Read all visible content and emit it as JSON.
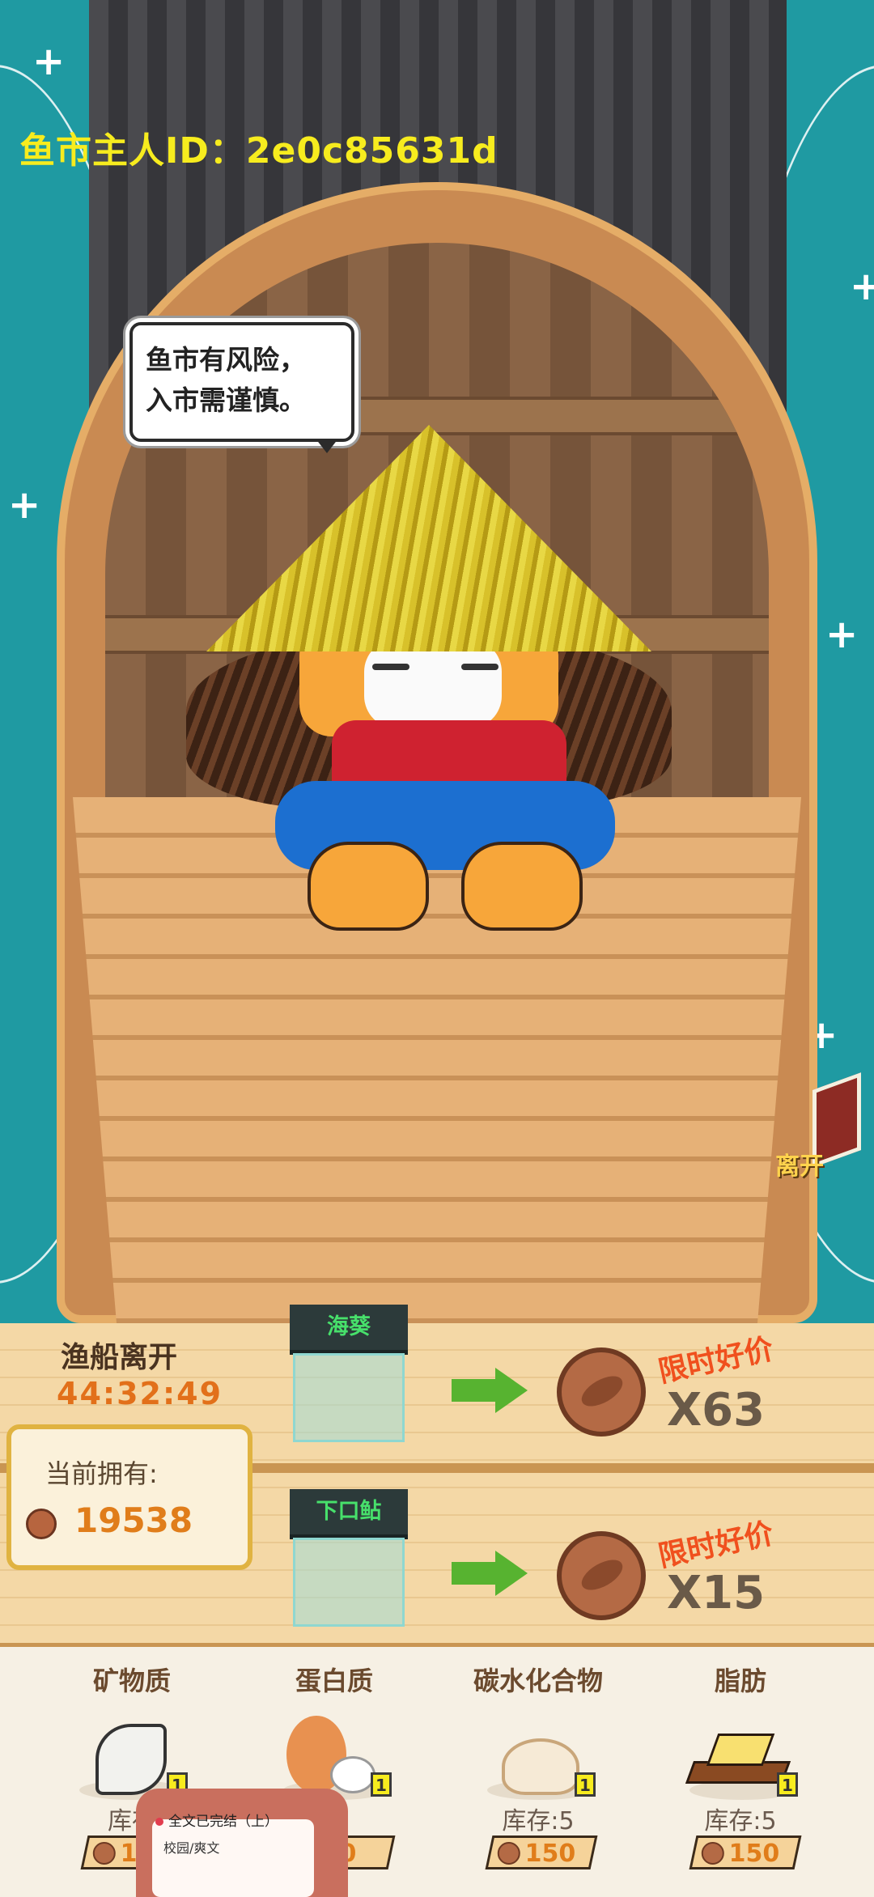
{
  "header": {
    "owner_id": "鱼市主人ID：2e0c85631d"
  },
  "speech": {
    "line1": "鱼市有风险，",
    "line2": "入市需谨慎。"
  },
  "leave": {
    "label": "离开"
  },
  "boat": {
    "title": "渔船离开",
    "timer": "44:32:49",
    "owned_label": "当前拥有:",
    "owned_value": "19538"
  },
  "offers": [
    {
      "item": "海葵",
      "deal": "限时好价",
      "qty": "X63"
    },
    {
      "item": "下口鲇",
      "deal": "限时好价",
      "qty": "X15"
    }
  ],
  "shop": {
    "categories": [
      {
        "name": "矿物质",
        "stock": "库存",
        "price": "1",
        "badge": "1",
        "icon": "shell-icon"
      },
      {
        "name": "蛋白质",
        "stock": ":5",
        "price": "50",
        "badge": "1",
        "icon": "egg-icon"
      },
      {
        "name": "碳水化合物",
        "stock": "库存:5",
        "price": "150",
        "badge": "1",
        "icon": "bun-icon"
      },
      {
        "name": "脂肪",
        "stock": "库存:5",
        "price": "150",
        "badge": "1",
        "icon": "butter-icon"
      }
    ]
  },
  "overlay": {
    "title": "全文已完结（上）",
    "subtitle": "校园/爽文"
  },
  "colors": {
    "sea": "#1f9aa2",
    "id_text": "#f7ec1e",
    "timer": "#e2701a",
    "deal": "#f0501e"
  }
}
